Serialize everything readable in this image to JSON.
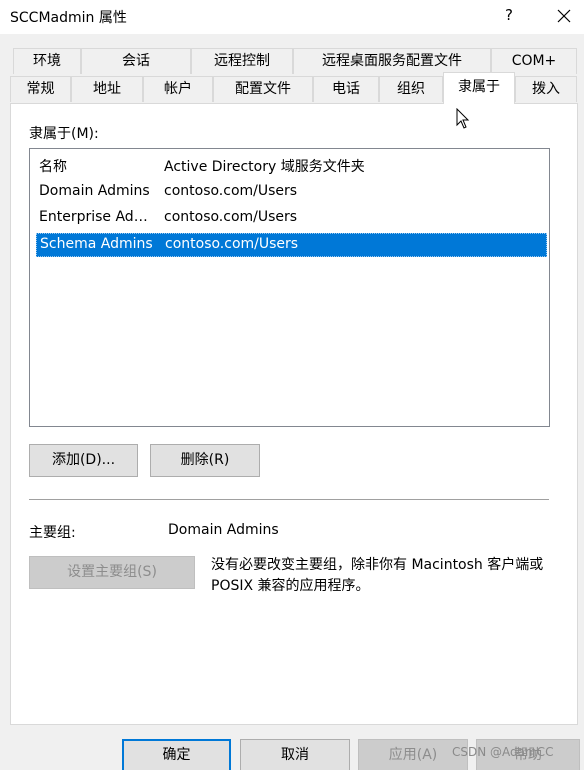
{
  "window": {
    "title": "SCCMadmin 属性",
    "help_label": "?"
  },
  "tabs": {
    "row1": [
      "环境",
      "会话",
      "远程控制",
      "远程桌面服务配置文件",
      "COM+"
    ],
    "row2": [
      "常规",
      "地址",
      "帐户",
      "配置文件",
      "电话",
      "组织",
      "隶属于",
      "拨入"
    ],
    "active": "隶属于"
  },
  "member_of": {
    "label": "隶属于(M):",
    "columns": [
      "名称",
      "Active Directory 域服务文件夹"
    ],
    "rows": [
      {
        "name": "Domain Admins",
        "folder": "contoso.com/Users",
        "selected": false
      },
      {
        "name": "Enterprise Admins",
        "folder": "contoso.com/Users",
        "selected": false
      },
      {
        "name": "Schema Admins",
        "folder": "contoso.com/Users",
        "selected": true
      }
    ]
  },
  "buttons": {
    "add": "添加(D)...",
    "remove": "删除(R)",
    "set_primary": "设置主要组(S)",
    "ok": "确定",
    "cancel": "取消",
    "apply": "应用(A)",
    "help": "帮助"
  },
  "primary_group": {
    "label": "主要组:",
    "value": "Domain Admins",
    "note": "没有必要改变主要组，除非你有 Macintosh 客户端或 POSIX 兼容的应用程序。"
  },
  "watermark": "CSDN @AdamCC",
  "colors": {
    "selection": "#0078d7",
    "panel": "#ffffff",
    "background": "#f0f0f0"
  }
}
